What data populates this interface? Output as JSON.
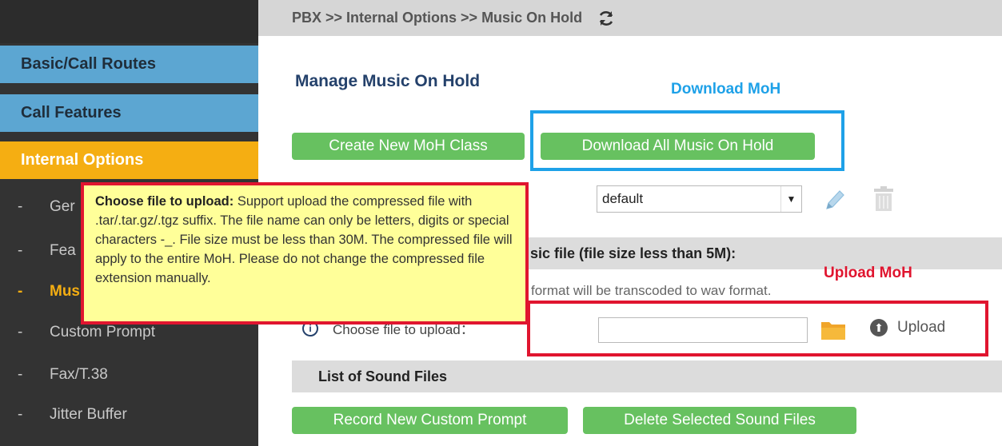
{
  "breadcrumb": "PBX >> Internal Options >> Music On Hold",
  "sidebar": {
    "main_items": [
      {
        "label": "Basic/Call Routes"
      },
      {
        "label": "Call Features"
      },
      {
        "label": "Internal Options"
      }
    ],
    "sub_items": [
      {
        "label": "Ger"
      },
      {
        "label": "Fea"
      },
      {
        "label": "Mus"
      },
      {
        "label": "Custom Prompt"
      },
      {
        "label": "Fax/T.38"
      },
      {
        "label": "Jitter Buffer"
      }
    ]
  },
  "main": {
    "title": "Manage Music On Hold",
    "create_button": "Create New MoH Class",
    "download_button": "Download All Music On Hold",
    "moh_class_select": "default",
    "upload_section_title": "sic file (file size less than 5M):",
    "format_note": "format will be transcoded to wav format.",
    "choose_file_label": "Choose file to upload：",
    "upload_label": "Upload",
    "list_title": "List of Sound Files",
    "record_button": "Record New Custom Prompt",
    "delete_button": "Delete Selected Sound Files"
  },
  "annotations": {
    "download_label": "Download MoH",
    "upload_label": "Upload MoH"
  },
  "tooltip": {
    "title": "Choose file to upload:",
    "body": " Support upload the compressed file with .tar/.tar.gz/.tgz suffix. The file name can only be letters, digits or special characters -_. File size must be less than 30M. The compressed file will apply to the entire MoH. Please do not change the compressed file extension manually."
  },
  "colors": {
    "sidebar_bg": "#333333",
    "nav_blue": "#5ca6d2",
    "nav_active": "#f5ae12",
    "button_green": "#67c160",
    "annotation_blue": "#1ea1e8",
    "annotation_red": "#e0152f",
    "tooltip_bg": "#ffff99",
    "title_blue": "#24416b"
  },
  "icons": {
    "refresh": "refresh-icon",
    "edit": "pencil-icon",
    "delete": "trash-icon",
    "folder": "folder-icon",
    "upload": "upload-icon",
    "info": "info-icon",
    "dropdown": "chevron-down-icon"
  }
}
